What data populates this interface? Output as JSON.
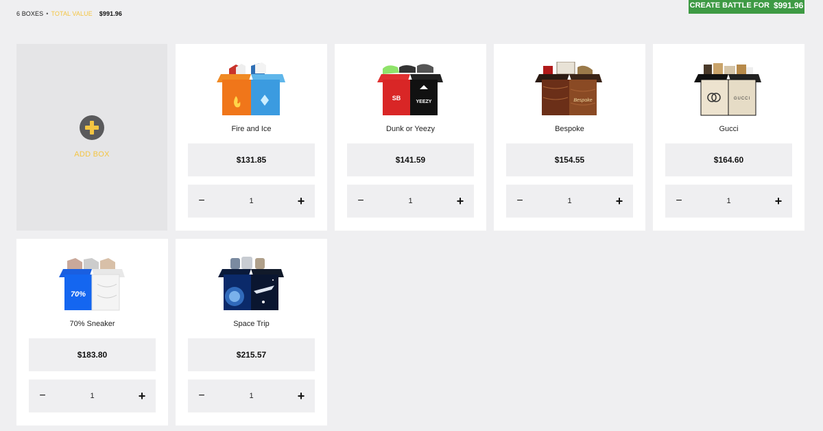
{
  "summary": {
    "boxes_label": "6 BOXES",
    "separator": "•",
    "total_value_label": "TOTAL VALUE",
    "total_value": "$991.96"
  },
  "create_battle": {
    "label": "CREATE BATTLE FOR",
    "amount": "$991.96"
  },
  "add_box": {
    "label": "ADD BOX",
    "icon": "plus-circle-icon"
  },
  "boxes": [
    {
      "name": "Fire and Ice",
      "price": "$131.85",
      "quantity": "1",
      "minus": "−",
      "plus": "+",
      "image": "fire-and-ice-box-image"
    },
    {
      "name": "Dunk or Yeezy",
      "price": "$141.59",
      "quantity": "1",
      "minus": "−",
      "plus": "+",
      "image": "dunk-or-yeezy-box-image",
      "labels": {
        "left": "SB",
        "right": "YEEZY"
      }
    },
    {
      "name": "Bespoke",
      "price": "$154.55",
      "quantity": "1",
      "minus": "−",
      "plus": "+",
      "image": "bespoke-box-image",
      "labels": {
        "front": "Bespoke"
      }
    },
    {
      "name": "Gucci",
      "price": "$164.60",
      "quantity": "1",
      "minus": "−",
      "plus": "+",
      "image": "gucci-box-image",
      "labels": {
        "front": "GUCCI"
      }
    },
    {
      "name": "70% Sneaker",
      "price": "$183.80",
      "quantity": "1",
      "minus": "−",
      "plus": "+",
      "image": "sneaker-70-box-image",
      "labels": {
        "front": "70%"
      }
    },
    {
      "name": "Space Trip",
      "price": "$215.57",
      "quantity": "1",
      "minus": "−",
      "plus": "+",
      "image": "space-trip-box-image"
    }
  ],
  "colors": {
    "accent_yellow": "#f4c542",
    "create_green": "#3e9a44",
    "background": "#efeff1"
  }
}
